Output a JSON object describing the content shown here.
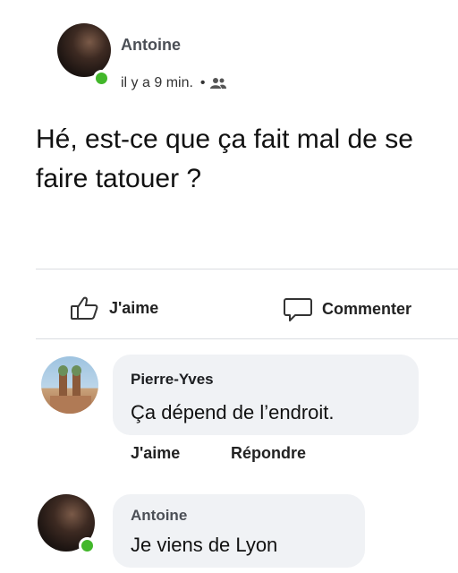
{
  "post": {
    "author": "Antoine",
    "timestamp": "il y a 9 min.",
    "separator": "•",
    "audience_icon": "friends-icon",
    "text": "Hé, est-ce que ça fait mal de se faire tatouer ?"
  },
  "actions": {
    "like_label": "J'aime",
    "comment_label": "Commenter"
  },
  "comments": [
    {
      "author": "Pierre-Yves",
      "text": "Ça dépend de l’endroit.",
      "like_label": "J'aime",
      "reply_label": "Répondre"
    },
    {
      "author": "Antoine",
      "text": "Je viens de Lyon"
    }
  ],
  "colors": {
    "online": "#42b72a",
    "bubble": "#f0f2f5",
    "divider": "#dadde1"
  }
}
